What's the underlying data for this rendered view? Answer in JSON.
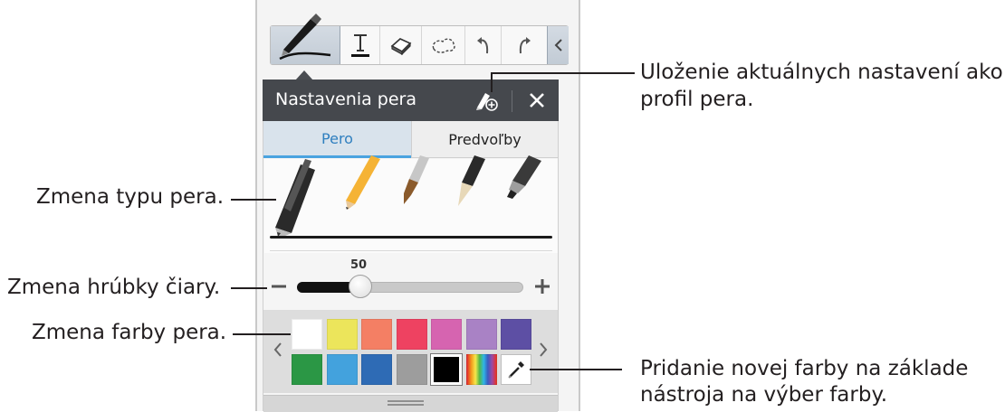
{
  "panel": {
    "title": "Nastavenia pera",
    "tabs": [
      {
        "label": "Pero",
        "active": true
      },
      {
        "label": "Predvoľby",
        "active": false
      }
    ],
    "pen_types": [
      "ballpoint-pen",
      "pencil",
      "brush",
      "fountain-pen",
      "marker"
    ],
    "thickness": {
      "value": "50",
      "level_fraction": 0.28
    },
    "colors": {
      "row1": [
        "#ffffff",
        "#ece55b",
        "#f47f64",
        "#ee4261",
        "#d664b0",
        "#a982c5",
        "#5d4fa4"
      ],
      "row2": [
        "#2b9745",
        "#43a2dd",
        "#2e6bb5",
        "#9d9d9d",
        "#000000",
        "rainbow-picker",
        "eyedropper"
      ]
    }
  },
  "toolbar": {
    "tools": [
      "pen-tool",
      "text-tool",
      "eraser-tool",
      "selection-tool",
      "undo",
      "redo",
      "collapse"
    ]
  },
  "callouts": {
    "save_profile": "Uloženie aktuálnych nastavení ako\nprofil pera.",
    "save_profile_line1": "Uloženie aktuálnych nastavení ako",
    "save_profile_line2": "profil pera.",
    "pen_type": "Zmena typu pera.",
    "thickness": "Zmena hrúbky čiary.",
    "color": "Zmena farby pera.",
    "add_color_line1": "Pridanie novej farby na základe",
    "add_color_line2": "nástroja na výber farby."
  },
  "accent_colors": {
    "tab_active_text": "#2f7fbf",
    "tab_underline": "#4aa3e0",
    "header_bg": "#45484d"
  }
}
